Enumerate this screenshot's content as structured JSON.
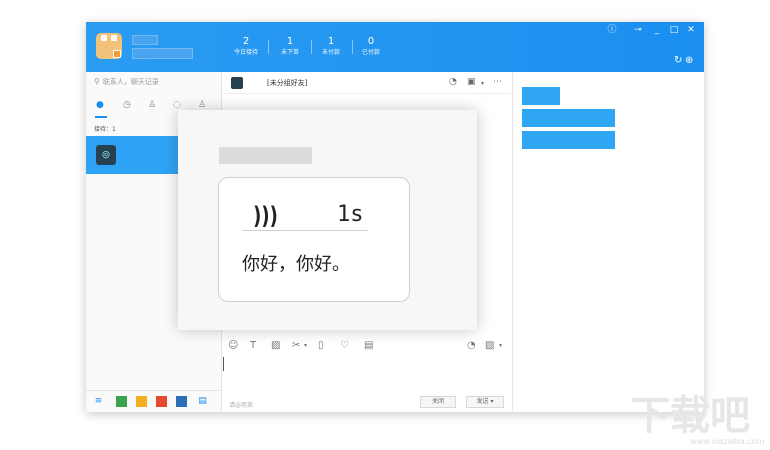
{
  "header": {
    "stats": [
      {
        "value": "2",
        "label": "今日接待"
      },
      {
        "value": "1",
        "label": "未下单"
      },
      {
        "value": "1",
        "label": "未付款"
      },
      {
        "value": "0",
        "label": "已付款"
      }
    ],
    "window_controls": [
      "info-icon",
      "pin-icon",
      "minimize-icon",
      "maximize-icon",
      "close-icon"
    ]
  },
  "sidebar": {
    "search_placeholder": "联系人，聊天记录",
    "tabs": [
      "chat-icon",
      "clock-icon",
      "person-icon",
      "group-icon",
      "team-icon"
    ],
    "counter": "接待：1",
    "contacts": [
      {
        "avatar": "contact-avatar"
      }
    ],
    "bottom_icons": [
      "menu-icon",
      "app-icon-1",
      "app-icon-2",
      "app-icon-3",
      "app-icon-4",
      "app-icon-5"
    ]
  },
  "chat": {
    "header_title": "[未分组好友]",
    "toolbar_icons": [
      "emoji-icon",
      "text-icon",
      "image-icon",
      "cut-icon",
      "vibrate-icon",
      "heart-icon",
      "trash-icon",
      "history-icon",
      "file-icon"
    ],
    "input_hint": "请@用卖",
    "close_label": "关闭",
    "send_label": "发送",
    "send_menu": "▾"
  },
  "modal": {
    "voice_icon": "voice-wave-icon",
    "voice_glyph": ")))",
    "duration": "1s",
    "message": "你好，你好。"
  },
  "watermark": {
    "text": "下载吧",
    "sub": "www.xiazaiba.com"
  },
  "colors": {
    "header_blue": "#1a8ff0",
    "selected_row": "#2ea3f5",
    "placeholder_blue": "#2fa6f4"
  }
}
